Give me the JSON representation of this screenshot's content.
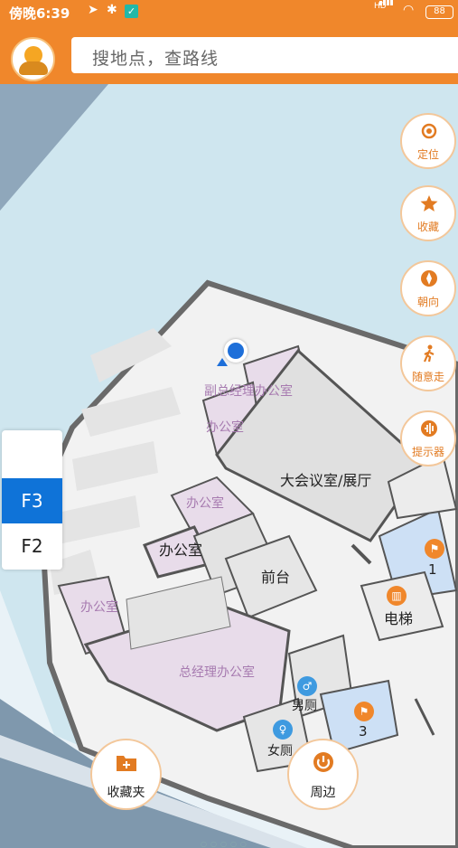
{
  "status_bar": {
    "time": "傍晚6:39",
    "battery": "88",
    "network": "HD"
  },
  "search": {
    "placeholder": "搜地点，查路线"
  },
  "controls": [
    {
      "label": "定位",
      "icon": "locate-icon"
    },
    {
      "label": "收藏",
      "icon": "star-icon"
    },
    {
      "label": "朝向",
      "icon": "compass-icon"
    },
    {
      "label": "随意走",
      "icon": "walk-icon"
    },
    {
      "label": "提示器",
      "icon": "sound-icon"
    }
  ],
  "floors": {
    "active": "F3",
    "other": "F2"
  },
  "map": {
    "rooms": {
      "vice_gm_office": "副总经理办公室",
      "office_small_1": "办公室",
      "conference": "大会议室/展厅",
      "office_small_2": "办公室",
      "office_dark": "办公室",
      "reception": "前台",
      "office_left": "办公室",
      "elevator": "电梯",
      "gm_office": "总经理办公室",
      "men_restroom": "男厕",
      "women_restroom": "女厕",
      "num_1": "1",
      "num_3": "3"
    }
  },
  "bottom": {
    "favorites_label": "收藏夹",
    "nearby_label": "周边"
  },
  "colors": {
    "accent": "#f0872b",
    "active_floor": "#0f73d8",
    "room_fill": "#e8dcea",
    "wall": "#6a6a6a"
  }
}
